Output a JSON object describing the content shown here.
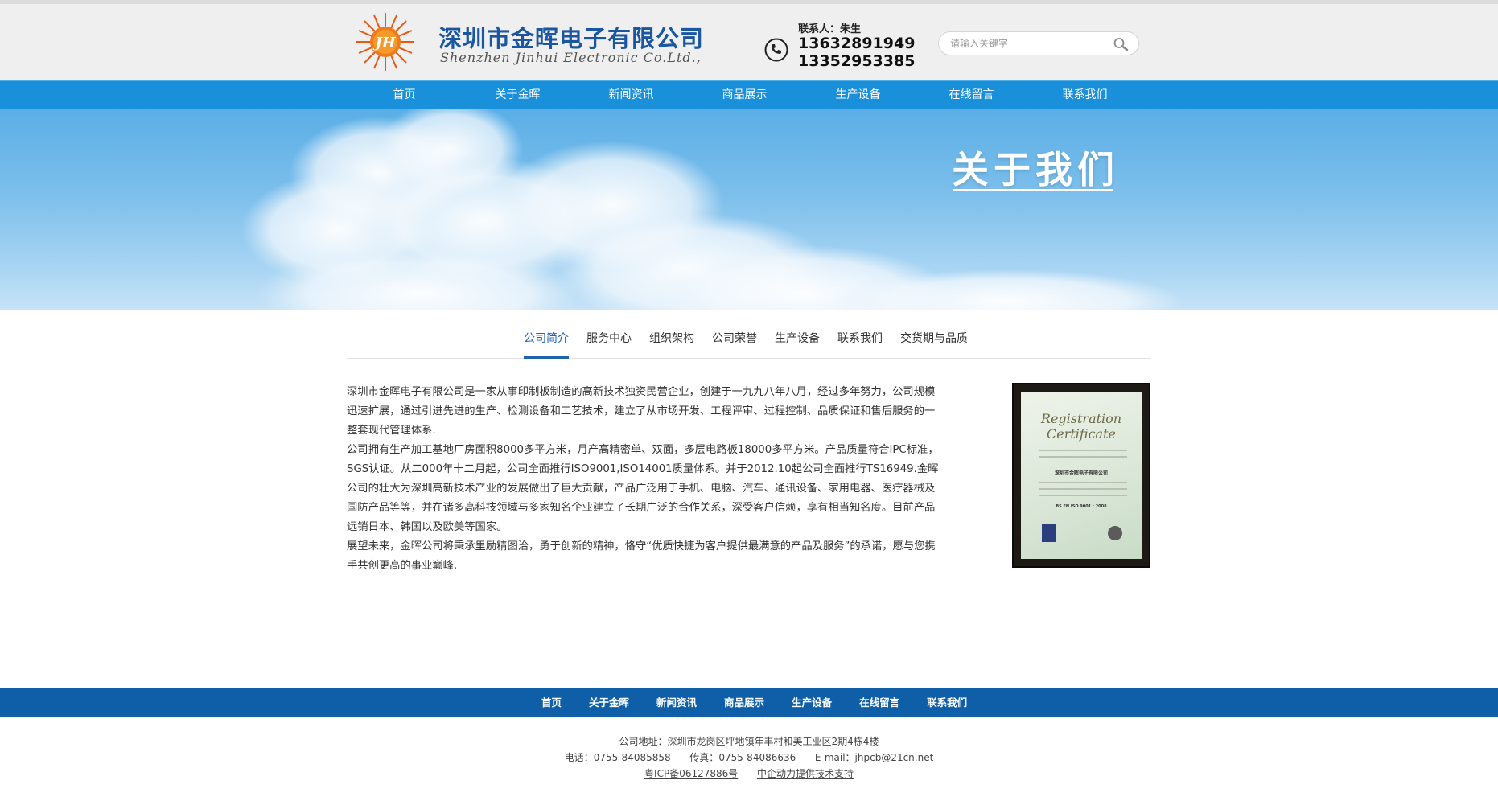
{
  "header": {
    "company_cn": "深圳市金晖电子有限公司",
    "company_en": "Shenzhen Jinhui Electronic Co.Ltd.,",
    "logo_text": "JH",
    "contact_person": "联系人：朱生",
    "phone1": "13632891949",
    "phone2": "13352953385",
    "search_placeholder": "请输入关键字"
  },
  "nav": {
    "items": [
      {
        "label": "首页"
      },
      {
        "label": "关于金晖"
      },
      {
        "label": "新闻资讯"
      },
      {
        "label": "商品展示"
      },
      {
        "label": "生产设备"
      },
      {
        "label": "在线留言"
      },
      {
        "label": "联系我们"
      }
    ]
  },
  "banner": {
    "title": "关于我们"
  },
  "subtabs": {
    "items": [
      {
        "label": "公司简介",
        "active": true
      },
      {
        "label": "服务中心"
      },
      {
        "label": "组织架构"
      },
      {
        "label": "公司荣誉"
      },
      {
        "label": "生产设备"
      },
      {
        "label": "联系我们"
      },
      {
        "label": "交货期与品质"
      }
    ]
  },
  "content": {
    "paragraphs": [
      "深圳市金晖电子有限公司是一家从事印制板制造的高新技术独资民营企业，创建于一九九八年八月，经过多年努力，公司规模迅速扩展，通过引进先进的生产、检测设备和工艺技术，建立了从市场开发、工程评审、过程控制、品质保证和售后服务的一整套现代管理体系.",
      "公司拥有生产加工基地厂房面积8000多平方米，月产高精密单、双面，多层电路板18000多平方米。产品质量符合IPC标准，SGS认证。从二000年十二月起，公司全面推行ISO9001,ISO14001质量体系。并于2012.10起公司全面推行TS16949.金晖公司的壮大为深圳高新技术产业的发展做出了巨大贡献，产品广泛用于手机、电脑、汽车、通讯设备、家用电器、医疗器械及国防产品等等，并在诸多高科技领域与多家知名企业建立了长期广泛的合作关系，深受客户信赖，享有相当知名度。目前产品远销日本、韩国以及欧美等国家。",
      "展望未来，金晖公司将秉承里励精图治，勇于创新的精神，恪守“优质快捷为客户提供最满意的产品及服务”的承诺，愿与您携手共创更高的事业巅峰."
    ],
    "certificate": {
      "title_line1": "Registration",
      "title_line2": "Certificate",
      "company": "深圳市金晖电子有限公司",
      "standard": "BS EN ISO 9001 : 2008"
    }
  },
  "footer": {
    "nav": [
      {
        "label": "首页"
      },
      {
        "label": "关于金晖"
      },
      {
        "label": "新闻资讯"
      },
      {
        "label": "商品展示"
      },
      {
        "label": "生产设备"
      },
      {
        "label": "在线留言"
      },
      {
        "label": "联系我们"
      }
    ],
    "address": "公司地址：深圳市龙岗区坪地镇年丰村和美工业区2期4栋4楼",
    "tel_label": "电话：",
    "tel": "0755-84085858",
    "fax_label": "传真：",
    "fax": "0755-84086636",
    "email_label": "E-mail：",
    "email": "jhpcb@21cn.net",
    "icp": "粤ICP备06127886号",
    "tech_support": "中企动力提供技术支持"
  },
  "colors": {
    "nav_bg": "#1a8fda",
    "footer_nav_bg": "#0e5ea8",
    "brand_blue": "#1b56a0",
    "active_tab": "#1f63b0"
  }
}
